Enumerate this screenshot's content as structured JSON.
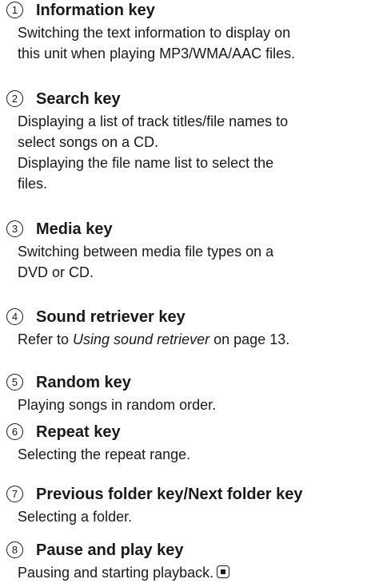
{
  "items": [
    {
      "number": "1",
      "title": "Information key",
      "lines": [
        "Switching the text information to display on",
        "this unit when playing MP3/WMA/AAC files."
      ]
    },
    {
      "number": "2",
      "title": "Search key",
      "lines": [
        "Displaying a list of track titles/file names to",
        "select songs on a CD.",
        "Displaying the file name list to select the",
        "files."
      ]
    },
    {
      "number": "3",
      "title": "Media key",
      "lines": [
        "Switching between media file types on a",
        "DVD or CD."
      ]
    },
    {
      "number": "4",
      "title": "Sound retriever key",
      "ref_prefix": "Refer to ",
      "ref_italic": "Using sound retriever",
      "ref_suffix": " on page 13."
    },
    {
      "number": "5",
      "title": "Random key",
      "lines": [
        "Playing songs in random order."
      ]
    },
    {
      "number": "6",
      "title": "Repeat key",
      "lines": [
        "Selecting the repeat range."
      ]
    },
    {
      "number": "7",
      "title": "Previous folder key/Next folder key",
      "lines": [
        "Selecting a folder."
      ]
    },
    {
      "number": "8",
      "title": "Pause and play key",
      "lines": [
        "Pausing and starting playback."
      ],
      "end_icon": "end-of-section-icon"
    }
  ]
}
